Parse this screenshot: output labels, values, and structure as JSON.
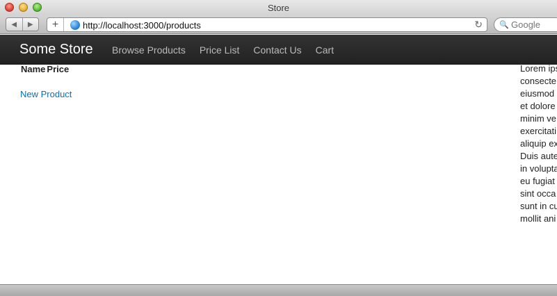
{
  "window": {
    "title": "Store"
  },
  "toolbar": {
    "url": "http://localhost:3000/products",
    "search_placeholder": "Google"
  },
  "navbar": {
    "brand": "Some Store",
    "links": [
      "Browse Products",
      "Price List",
      "Contact Us",
      "Cart"
    ]
  },
  "table": {
    "headers": [
      "Name",
      "Price"
    ]
  },
  "actions": {
    "new_product": "New Product"
  },
  "sidebar": {
    "text": "Lorem ips\nconsecte\neiusmod\net dolore\nminim ve\nexercitati\naliquip ex\nDuis aute\nin volupta\neu fugiat\nsint occa\nsunt in cu\nmollit ani"
  },
  "colors": {
    "link": "#0a6fb7",
    "navbar": "#222222"
  }
}
